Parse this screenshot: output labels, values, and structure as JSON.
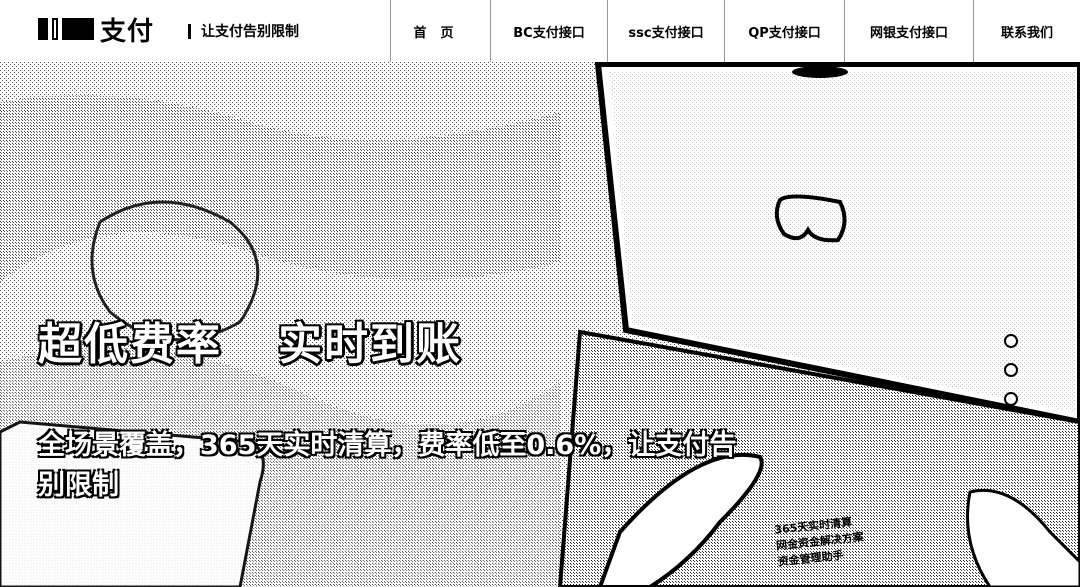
{
  "header": {
    "logo_text": "支付",
    "slogan": "让支付告别限制"
  },
  "nav": {
    "items": [
      {
        "label": "首页"
      },
      {
        "label": "BC支付接口"
      },
      {
        "label": "ssc支付接口"
      },
      {
        "label": "QP支付接口"
      },
      {
        "label": "网银支付接口"
      },
      {
        "label": "联系我们"
      }
    ]
  },
  "hero": {
    "headline_1": "超低费率",
    "headline_2": "实时到账",
    "subline": "全场景覆盖，365天实时清算，费率低至0.6%，让支付告别限制",
    "slide_count": 3,
    "card_lines": [
      "365天实时清算",
      "网金资金解决方案",
      "资金管理助手"
    ]
  }
}
